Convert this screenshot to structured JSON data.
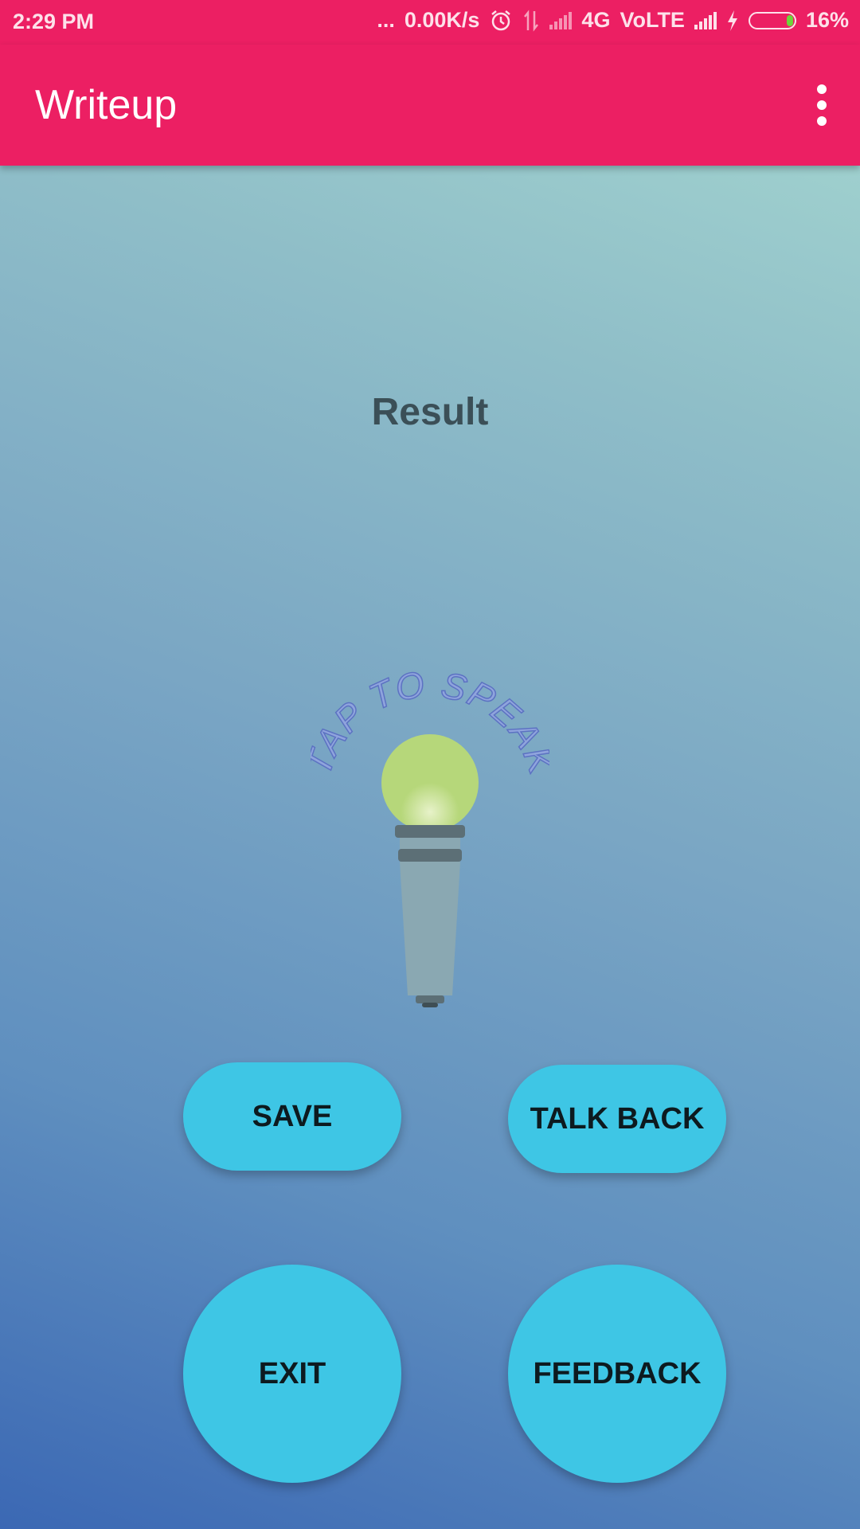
{
  "status_bar": {
    "time": "2:29 PM",
    "dots": "...",
    "speed": "0.00K/s",
    "network": "4G",
    "volte": "VoLTE",
    "battery_percent": "16%",
    "battery_level": 0.16,
    "icons": [
      "alarm-icon",
      "data-arrows-icon",
      "signal-icon",
      "signal-icon",
      "charging-icon",
      "battery-icon"
    ]
  },
  "app_bar": {
    "title": "Writeup",
    "menu_icon": "overflow-menu-icon"
  },
  "main": {
    "result_text": "Result",
    "mic_caption": "TAP TO SPEAK",
    "mic_icon": "microphone-icon"
  },
  "buttons": {
    "save": "SAVE",
    "talk_back": "TALK BACK",
    "exit": "EXIT",
    "feedback": "FEEDBACK"
  },
  "colors": {
    "app_bar": "#ec1f63",
    "button": "#3ec6e5",
    "mic_head": "#b6d77a",
    "mic_body": "#8aa8b2",
    "caption": "#6f86c9"
  }
}
